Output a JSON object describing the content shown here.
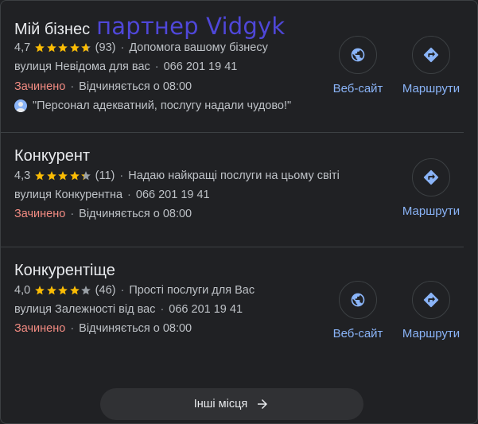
{
  "listings": [
    {
      "name": "Мій бізнес",
      "partner_label": "партнер Vidgyk",
      "rating": "4,7",
      "star_fill": [
        1,
        1,
        1,
        1,
        0.7
      ],
      "reviews": "(93)",
      "description": "Допомога вашому бізнесу",
      "address": "вулиця Невідома для вас",
      "phone": "066 201 19 41",
      "status": "Зачинено",
      "hours": "Відчиняється о 08:00",
      "review_quote": "\"Персонал адекватний, послугу надали чудово!\"",
      "website_label": "Веб-сайт",
      "directions_label": "Маршрути"
    },
    {
      "name": "Конкурент",
      "rating": "4,3",
      "star_fill": [
        1,
        1,
        1,
        1,
        0.3
      ],
      "reviews": "(11)",
      "description": "Надаю найкращі послуги на цьому світі",
      "address": "вулиця Конкурентна",
      "phone": "066 201 19 41",
      "status": "Зачинено",
      "hours": "Відчиняється о 08:00",
      "directions_label": "Маршрути"
    },
    {
      "name": "Конкурентіще",
      "rating": "4,0",
      "star_fill": [
        1,
        1,
        1,
        1,
        0
      ],
      "reviews": "(46)",
      "description": "Прості послуги для Вас",
      "address": "вулиця Залежності від вас",
      "phone": "066 201 19 41",
      "status": "Зачинено",
      "hours": "Відчиняється о 08:00",
      "website_label": "Веб-сайт",
      "directions_label": "Маршрути"
    }
  ],
  "more_places_label": "Інші місця",
  "separator": "·",
  "colors": {
    "background": "#202124",
    "star": "#fbbc04",
    "star_empty": "#9aa0a6",
    "closed": "#f28b82",
    "link": "#8ab4f8",
    "partner": "#4f47d9"
  }
}
